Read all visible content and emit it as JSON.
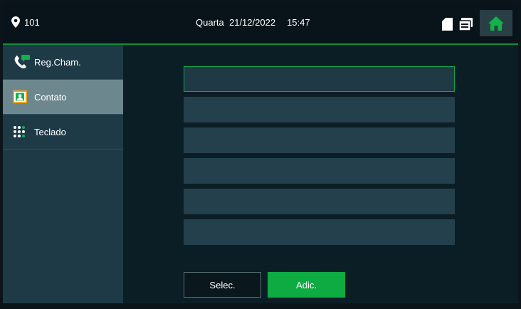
{
  "header": {
    "location_number": "101",
    "weekday": "Quarta",
    "date": "21/12/2022",
    "time": "15:47",
    "icons": [
      "location-pin-icon",
      "sd-card-icon",
      "message-icon",
      "home-icon"
    ]
  },
  "sidebar": {
    "items": [
      {
        "label": "Reg.Cham.",
        "icon": "call-log-icon",
        "active": false
      },
      {
        "label": "Contato",
        "icon": "contact-icon",
        "active": true
      },
      {
        "label": "Teclado",
        "icon": "keypad-icon",
        "active": false
      }
    ]
  },
  "contacts": {
    "rows": [
      "",
      "",
      "",
      "",
      "",
      ""
    ],
    "selected_index": 0
  },
  "buttons": {
    "select_label": "Selec.",
    "add_label": "Adic."
  },
  "colors": {
    "accent_green": "#0eaa42",
    "topbar_border": "#0b8f3d",
    "sidebar_bg": "#1e3a47",
    "sidebar_active": "#6d878f",
    "row_bg": "#24404d"
  }
}
